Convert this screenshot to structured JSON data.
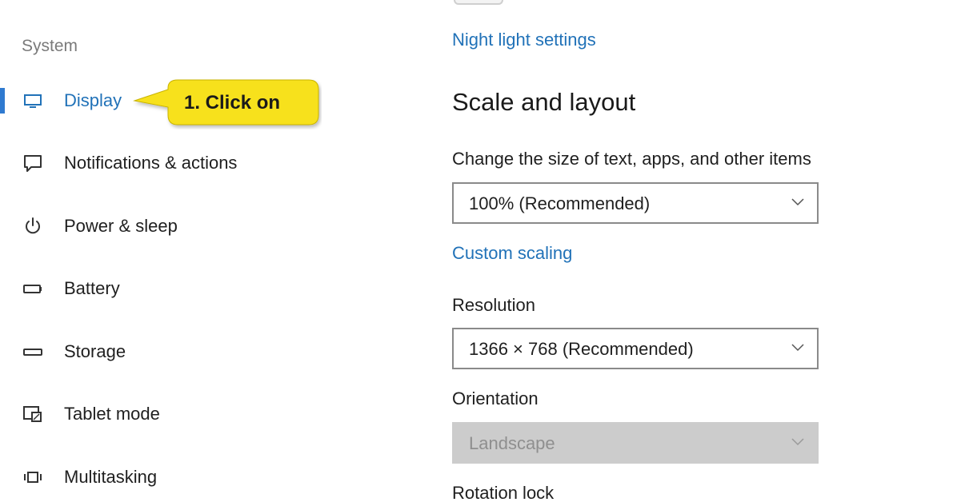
{
  "sidebar": {
    "section_label": "System",
    "items": [
      {
        "label": "Display",
        "icon": "monitor-icon",
        "active": true
      },
      {
        "label": "Notifications & actions",
        "icon": "notification-icon"
      },
      {
        "label": "Power & sleep",
        "icon": "power-icon"
      },
      {
        "label": "Battery",
        "icon": "battery-icon"
      },
      {
        "label": "Storage",
        "icon": "storage-icon"
      },
      {
        "label": "Tablet mode",
        "icon": "tablet-mode-icon"
      },
      {
        "label": "Multitasking",
        "icon": "multitasking-icon"
      }
    ],
    "callout": {
      "text": "1. Click on",
      "color": "#f7e11b"
    }
  },
  "main": {
    "night_light_link": "Night light settings",
    "scale_layout": {
      "heading": "Scale and layout",
      "scale_label": "Change the size of text, apps, and other items",
      "scale_value": "100% (Recommended)",
      "custom_scaling_link": "Custom scaling",
      "resolution_label": "Resolution",
      "resolution_value": "1366 × 768 (Recommended)",
      "orientation_label": "Orientation",
      "orientation_value": "Landscape",
      "rotation_lock_label": "Rotation lock"
    }
  },
  "colors": {
    "accent": "#2172b8",
    "active_bar": "#2f7ad0",
    "disabled_fill": "#cccccc"
  }
}
